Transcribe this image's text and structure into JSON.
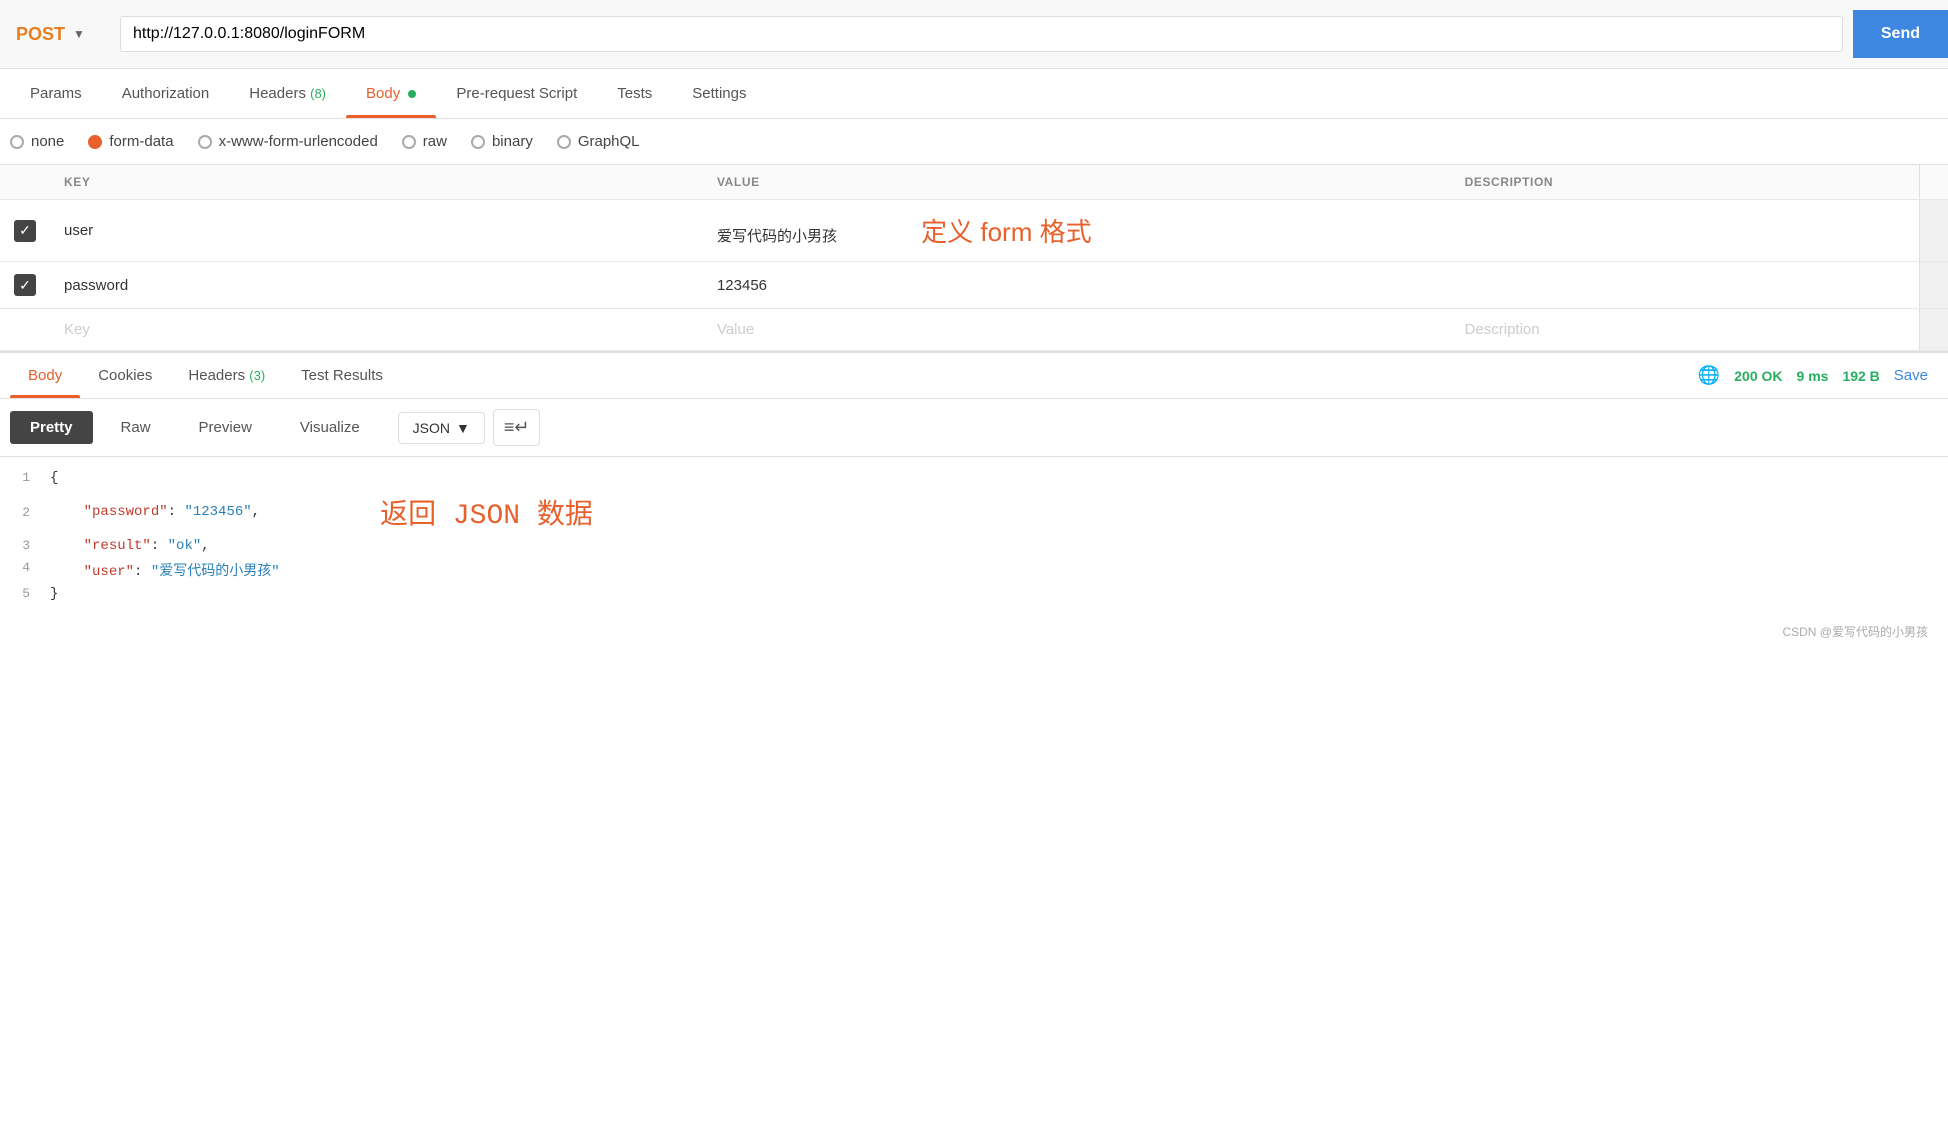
{
  "urlbar": {
    "method": "POST",
    "url": "http://127.0.0.1:8080/loginFORM",
    "send_label": "Send"
  },
  "tabs": [
    {
      "id": "params",
      "label": "Params",
      "active": false
    },
    {
      "id": "authorization",
      "label": "Authorization",
      "active": false
    },
    {
      "id": "headers",
      "label": "Headers",
      "badge": "(8)",
      "active": false
    },
    {
      "id": "body",
      "label": "Body",
      "dot": true,
      "active": true
    },
    {
      "id": "pre-request",
      "label": "Pre-request Script",
      "active": false
    },
    {
      "id": "tests",
      "label": "Tests",
      "active": false
    },
    {
      "id": "settings",
      "label": "Settings",
      "active": false
    }
  ],
  "body_types": [
    {
      "id": "none",
      "label": "none",
      "selected": false
    },
    {
      "id": "form-data",
      "label": "form-data",
      "selected": true
    },
    {
      "id": "x-www-form-urlencoded",
      "label": "x-www-form-urlencoded",
      "selected": false
    },
    {
      "id": "raw",
      "label": "raw",
      "selected": false
    },
    {
      "id": "binary",
      "label": "binary",
      "selected": false
    },
    {
      "id": "graphql",
      "label": "GraphQL",
      "selected": false
    }
  ],
  "table": {
    "columns": [
      "KEY",
      "VALUE",
      "DESCRIPTION"
    ],
    "rows": [
      {
        "checked": true,
        "key": "user",
        "value": "爱写代码的小男孩",
        "description": "",
        "annotation": "定义 form 格式"
      },
      {
        "checked": true,
        "key": "password",
        "value": "123456",
        "description": "",
        "annotation": ""
      },
      {
        "checked": false,
        "key": "",
        "value": "",
        "description": "",
        "annotation": "",
        "placeholder_key": "Key",
        "placeholder_value": "Value",
        "placeholder_desc": "Description"
      }
    ]
  },
  "response": {
    "tabs": [
      {
        "id": "body",
        "label": "Body",
        "active": true
      },
      {
        "id": "cookies",
        "label": "Cookies",
        "active": false
      },
      {
        "id": "headers",
        "label": "Headers",
        "badge": "(3)",
        "active": false
      },
      {
        "id": "test-results",
        "label": "Test Results",
        "active": false
      }
    ],
    "status": "200 OK",
    "time": "9 ms",
    "size": "192 B",
    "save_label": "Save",
    "format_tabs": [
      "Pretty",
      "Raw",
      "Preview",
      "Visualize"
    ],
    "active_format": "Pretty",
    "format_type": "JSON",
    "json_lines": [
      {
        "number": 1,
        "content": "{",
        "type": "bracket"
      },
      {
        "number": 2,
        "content": "    \"password\":  \"123456\",",
        "key": "password",
        "value": "123456",
        "type": "kv"
      },
      {
        "number": 3,
        "content": "    \"result\":  \"ok\",",
        "key": "result",
        "value": "ok",
        "type": "kv"
      },
      {
        "number": 4,
        "content": "    \"user\":  \"爱写代码的小男孩\"",
        "key": "user",
        "value": "爱写代码的小男孩",
        "type": "kv"
      },
      {
        "number": 5,
        "content": "}",
        "type": "bracket"
      }
    ],
    "annotation": "返回 JSON 数据"
  },
  "footer": {
    "text": "CSDN @爱写代码的小男孩"
  }
}
